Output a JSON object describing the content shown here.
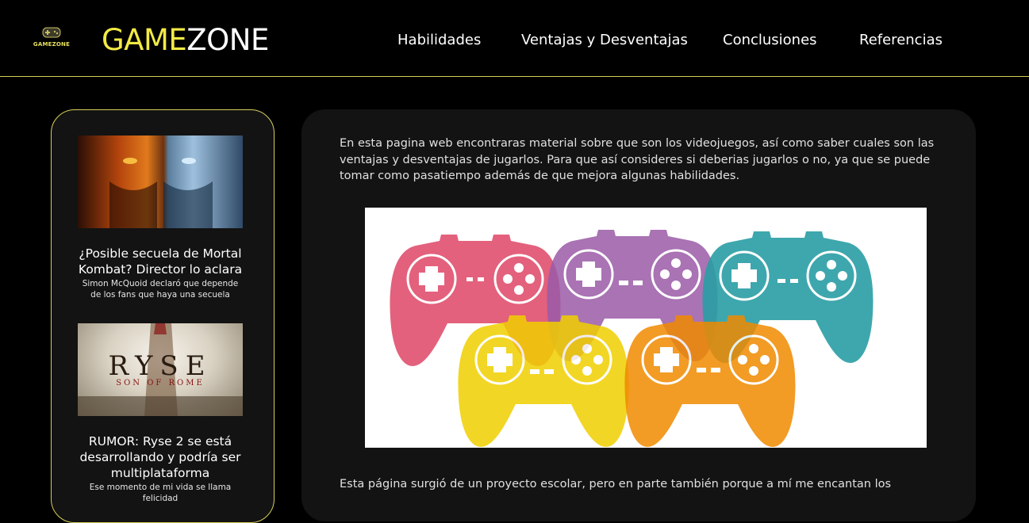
{
  "header": {
    "logo_small_text": "GAMEZONE",
    "brand_part1": "GAME",
    "brand_part2": "ZONE",
    "nav": [
      {
        "label": "Habilidades"
      },
      {
        "label": "Ventajas y Desventajas"
      },
      {
        "label": "Conclusiones"
      },
      {
        "label": "Referencias"
      }
    ]
  },
  "sidebar": {
    "cards": [
      {
        "title": "¿Posible secuela de Mortal Kombat? Director lo aclara",
        "summary": "Simon McQuoid declaró que depende de los fans que haya una secuela"
      },
      {
        "image_title": "RYSE",
        "image_subtitle": "SON OF ROME",
        "title": "RUMOR: Ryse 2 se está desarrollando y podría ser multiplataforma",
        "summary": "Ese momento de mi vida se llama felicidad"
      }
    ]
  },
  "main": {
    "intro": "En esta pagina web encontraras material sobre que son los videojuegos, así como saber cuales son las ventajas y desventajas de jugarlos. Para que así consideres si deberias jugarlos o no, ya que se puede tomar como pasatiempo además de que mejora algunas habilidades.",
    "outro": "Esta página surgió de un proyecto escolar, pero en parte también porque a mí me encantan los"
  },
  "colors": {
    "accent": "#f2ea45",
    "border": "#d8cf5a",
    "panel": "#131313",
    "controllers": [
      "#e0506e",
      "#9b5ba8",
      "#2a9ea5",
      "#f0cf00",
      "#f08a00"
    ]
  }
}
